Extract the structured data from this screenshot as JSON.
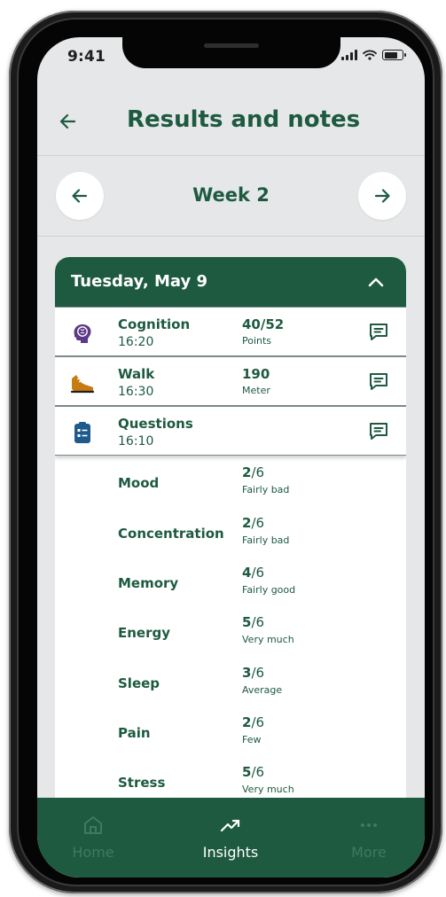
{
  "status": {
    "time": "9:41"
  },
  "header": {
    "title": "Results and notes"
  },
  "week": {
    "title": "Week 2"
  },
  "day": {
    "title": "Tuesday, May 9",
    "activities": [
      {
        "name": "Cognition",
        "time": "16:20",
        "value": "40/52",
        "unit": "Points",
        "icon": "brain-icon"
      },
      {
        "name": "Walk",
        "time": "16:30",
        "value": "190",
        "unit": "Meter",
        "icon": "shoe-icon"
      },
      {
        "name": "Questions",
        "time": "16:10",
        "value": "",
        "unit": "",
        "icon": "clipboard-icon"
      }
    ],
    "questions": [
      {
        "label": "Mood",
        "score": "2",
        "max": "/6",
        "desc": "Fairly bad"
      },
      {
        "label": "Concentration",
        "score": "2",
        "max": "/6",
        "desc": "Fairly bad"
      },
      {
        "label": "Memory",
        "score": "4",
        "max": "/6",
        "desc": "Fairly good"
      },
      {
        "label": "Energy",
        "score": "5",
        "max": "/6",
        "desc": "Very much"
      },
      {
        "label": "Sleep",
        "score": "3",
        "max": "/6",
        "desc": "Average"
      },
      {
        "label": "Pain",
        "score": "2",
        "max": "/6",
        "desc": "Few"
      },
      {
        "label": "Stress",
        "score": "5",
        "max": "/6",
        "desc": "Very much"
      }
    ]
  },
  "tabbar": {
    "home": "Home",
    "insights": "Insights",
    "more": "More"
  },
  "colors": {
    "brand_green": "#1d5a40",
    "background": "#e5e7e8",
    "inactive_tab": "#3d7b5f"
  }
}
